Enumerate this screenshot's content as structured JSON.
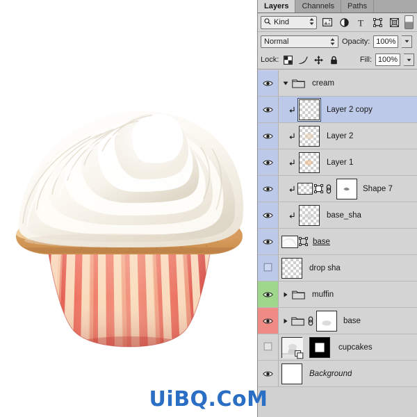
{
  "panel": {
    "tabs": [
      {
        "label": "Layers",
        "active": true
      },
      {
        "label": "Channels",
        "active": false
      },
      {
        "label": "Paths",
        "active": false
      }
    ],
    "filter": {
      "kind_label": "Kind",
      "search_icon": "search-icon",
      "icons": [
        "pixel-layer-icon",
        "adjustment-layer-icon",
        "type-layer-icon",
        "shape-layer-icon",
        "smart-object-icon"
      ],
      "toggle": "filter-enable-toggle"
    },
    "blend": {
      "mode": "Normal",
      "opacity_label": "Opacity:",
      "opacity_value": "100%"
    },
    "lock": {
      "label": "Lock:",
      "icons": [
        "lock-transparency-icon",
        "lock-image-icon",
        "lock-position-icon",
        "lock-all-icon"
      ],
      "fill_label": "Fill:",
      "fill_value": "100%"
    },
    "layers": [
      {
        "name": "cream",
        "type": "group",
        "visible": true,
        "selected": false,
        "expanded": true,
        "eye_color": "#bdc9e8",
        "indent": 0,
        "thumb": "folder",
        "clipped": false,
        "linked": false,
        "name_style": "normal"
      },
      {
        "name": "Layer 2 copy",
        "type": "layer",
        "visible": true,
        "selected": true,
        "eye_color": "#bdc9e8",
        "indent": 1,
        "thumb": "transparent",
        "clipped": true,
        "linked": false,
        "name_style": "normal"
      },
      {
        "name": "Layer 2",
        "type": "layer",
        "visible": true,
        "selected": false,
        "eye_color": "#bdc9e8",
        "indent": 1,
        "thumb": "transparent-faint",
        "clipped": true,
        "linked": false,
        "name_style": "normal"
      },
      {
        "name": "Layer 1",
        "type": "layer",
        "visible": true,
        "selected": false,
        "eye_color": "#bdc9e8",
        "indent": 1,
        "thumb": "transparent-faint",
        "clipped": true,
        "linked": false,
        "name_style": "normal"
      },
      {
        "name": "Shape 7",
        "type": "shape",
        "visible": true,
        "selected": false,
        "eye_color": "#bdc9e8",
        "indent": 1,
        "thumb": "shape-with-vector-mask",
        "clipped": true,
        "linked": true,
        "name_style": "normal"
      },
      {
        "name": "base_sha",
        "type": "layer",
        "visible": true,
        "selected": false,
        "eye_color": "#bdc9e8",
        "indent": 1,
        "thumb": "transparent-faint",
        "clipped": true,
        "linked": false,
        "name_style": "normal"
      },
      {
        "name": "base",
        "type": "shape",
        "visible": true,
        "selected": false,
        "eye_color": "#bdc9e8",
        "indent": 0,
        "thumb": "white-with-vector-mask",
        "clipped": false,
        "linked": false,
        "name_style": "underline"
      },
      {
        "name": "drop sha",
        "type": "layer",
        "visible": false,
        "selected": false,
        "eye_color": "#bdc9e8",
        "indent": 0,
        "thumb": "transparent",
        "clipped": false,
        "linked": false,
        "name_style": "normal"
      },
      {
        "name": "muffin",
        "type": "group",
        "visible": true,
        "selected": false,
        "expanded": false,
        "eye_color": "#9fd88c",
        "indent": 0,
        "thumb": "folder",
        "clipped": false,
        "linked": false,
        "name_style": "normal"
      },
      {
        "name": "base",
        "type": "group",
        "visible": true,
        "selected": false,
        "expanded": false,
        "eye_color": "#f08a85",
        "indent": 0,
        "thumb": "folder-with-mask",
        "clipped": false,
        "linked": true,
        "name_style": "normal"
      },
      {
        "name": "cupcakes",
        "type": "smart-object",
        "visible": false,
        "selected": false,
        "eye_color": "#d4d4d4",
        "indent": 0,
        "thumb": "smart-object-with-black-mask",
        "clipped": false,
        "linked": false,
        "name_style": "normal"
      },
      {
        "name": "Background",
        "type": "background",
        "visible": true,
        "selected": false,
        "eye_color": "#d4d4d4",
        "indent": 0,
        "thumb": "white",
        "clipped": false,
        "linked": false,
        "name_style": "italic"
      }
    ]
  },
  "canvas": {
    "artwork": "cupcake-illustration",
    "description": "Vanilla cupcake with white swirled frosting in a red striped paper liner"
  },
  "watermark": {
    "text": "UiBQ.CoM",
    "color": "#2b6fc4"
  }
}
